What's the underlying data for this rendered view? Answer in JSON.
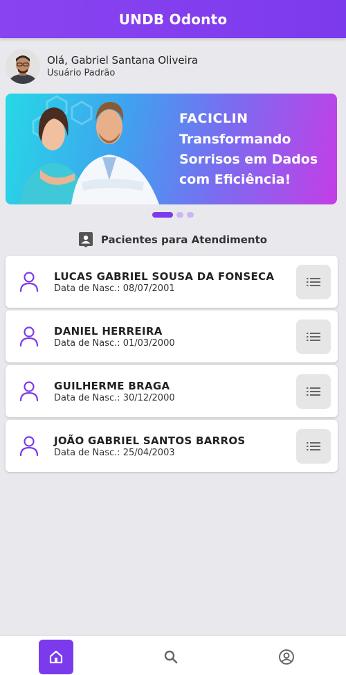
{
  "app": {
    "title": "UNDB Odonto"
  },
  "user": {
    "greeting": "Olá, Gabriel Santana Oliveira",
    "role": "Usuário Padrão",
    "avatar_icon": "user-photo"
  },
  "banner": {
    "brand": "FACICLIN",
    "line1": "Transformando",
    "line2": "Sorrisos em Dados",
    "line3": "com Eficiência!",
    "slide_index": 1,
    "slide_count": 3
  },
  "section": {
    "title": "Pacientes para Atendimento",
    "icon": "contact-card-icon"
  },
  "patients": [
    {
      "name": "LUCAS GABRIEL SOUSA DA FONSECA",
      "dob_label": "Data de Nasc.:",
      "dob": "08/07/2001"
    },
    {
      "name": "DANIEL HERREIRA",
      "dob_label": "Data de Nasc.:",
      "dob": "01/03/2000"
    },
    {
      "name": "GUILHERME BRAGA",
      "dob_label": "Data de Nasc.:",
      "dob": "30/12/2000"
    },
    {
      "name": "JOÃO GABRIEL SANTOS BARROS",
      "dob_label": "Data de Nasc.:",
      "dob": "25/04/2003"
    }
  ],
  "nav": {
    "items": [
      {
        "icon": "home-icon",
        "active": true
      },
      {
        "icon": "search-icon",
        "active": false
      },
      {
        "icon": "account-circle-icon",
        "active": false
      }
    ]
  },
  "colors": {
    "primary": "#7c3aed",
    "background": "#e9e8ec",
    "card": "#ffffff"
  }
}
